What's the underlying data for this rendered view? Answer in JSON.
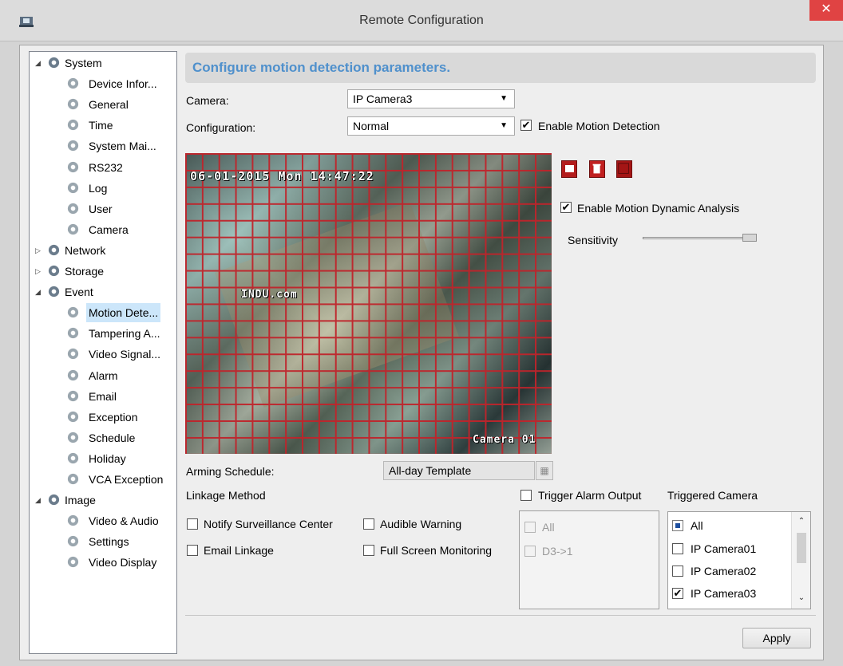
{
  "window": {
    "title": "Remote Configuration",
    "close_glyph": "✕"
  },
  "tree": {
    "items": [
      {
        "label": "System",
        "level": 0,
        "expanded": true,
        "icon": "gear-group-icon"
      },
      {
        "label": "Device Infor...",
        "level": 1,
        "icon": "gear-icon"
      },
      {
        "label": "General",
        "level": 1,
        "icon": "gear-icon"
      },
      {
        "label": "Time",
        "level": 1,
        "icon": "gear-icon"
      },
      {
        "label": "System Mai...",
        "level": 1,
        "icon": "gear-icon"
      },
      {
        "label": "RS232",
        "level": 1,
        "icon": "gear-icon"
      },
      {
        "label": "Log",
        "level": 1,
        "icon": "gear-icon"
      },
      {
        "label": "User",
        "level": 1,
        "icon": "gear-icon"
      },
      {
        "label": "Camera",
        "level": 1,
        "icon": "gear-icon"
      },
      {
        "label": "Network",
        "level": 0,
        "expanded": false,
        "icon": "gear-group-icon"
      },
      {
        "label": "Storage",
        "level": 0,
        "expanded": false,
        "icon": "gear-group-icon"
      },
      {
        "label": "Event",
        "level": 0,
        "expanded": true,
        "icon": "gear-group-icon"
      },
      {
        "label": "Motion Dete...",
        "level": 1,
        "selected": true,
        "icon": "gear-icon"
      },
      {
        "label": "Tampering A...",
        "level": 1,
        "icon": "gear-icon"
      },
      {
        "label": "Video Signal...",
        "level": 1,
        "icon": "gear-icon"
      },
      {
        "label": "Alarm",
        "level": 1,
        "icon": "gear-icon"
      },
      {
        "label": "Email",
        "level": 1,
        "icon": "gear-icon"
      },
      {
        "label": "Exception",
        "level": 1,
        "icon": "gear-icon"
      },
      {
        "label": "Schedule",
        "level": 1,
        "icon": "gear-icon"
      },
      {
        "label": "Holiday",
        "level": 1,
        "icon": "gear-icon"
      },
      {
        "label": "VCA Exception",
        "level": 1,
        "icon": "gear-icon"
      },
      {
        "label": "Image",
        "level": 0,
        "expanded": true,
        "icon": "gear-group-icon"
      },
      {
        "label": "Video & Audio",
        "level": 1,
        "icon": "gear-icon"
      },
      {
        "label": "Settings",
        "level": 1,
        "icon": "gear-icon"
      },
      {
        "label": "Video Display",
        "level": 1,
        "icon": "gear-icon"
      }
    ]
  },
  "main": {
    "header": "Configure motion detection parameters.",
    "camera_label": "Camera:",
    "camera_value": "IP Camera3",
    "config_label": "Configuration:",
    "config_value": "Normal",
    "enable_motion_label": "Enable Motion Detection",
    "enable_motion_checked": true,
    "osd_datetime": "06-01-2015 Mon 14:47:22",
    "osd_watermark": "INDU.com",
    "osd_camera": "Camera 01",
    "tools": [
      "draw-area-icon",
      "delete-icon",
      "draw-all-icon"
    ],
    "dynamic_analysis_label": "Enable Motion Dynamic Analysis",
    "dynamic_analysis_checked": true,
    "sensitivity_label": "Sensitivity",
    "sensitivity_level": 1.0,
    "arming_label": "Arming Schedule:",
    "arming_value": "All-day Template",
    "linkage_label": "Linkage Method",
    "notify_label": "Notify Surveillance Center",
    "audible_label": "Audible Warning",
    "email_label": "Email Linkage",
    "fullscreen_label": "Full Screen Monitoring",
    "trigger_alarm_label": "Trigger Alarm Output",
    "alarm_outputs": [
      "All",
      "D3->1"
    ],
    "triggered_camera_label": "Triggered Camera",
    "cameras": [
      {
        "label": "All",
        "state": "partial"
      },
      {
        "label": "IP Camera01",
        "state": "unchecked"
      },
      {
        "label": "IP Camera02",
        "state": "unchecked"
      },
      {
        "label": "IP Camera03",
        "state": "checked"
      }
    ],
    "apply_label": "Apply",
    "check_glyph": "✔",
    "scroll_up": "⌃",
    "scroll_down": "⌄",
    "caret": "▼",
    "arrow_expanded": "◢",
    "arrow_collapsed": "▷"
  }
}
